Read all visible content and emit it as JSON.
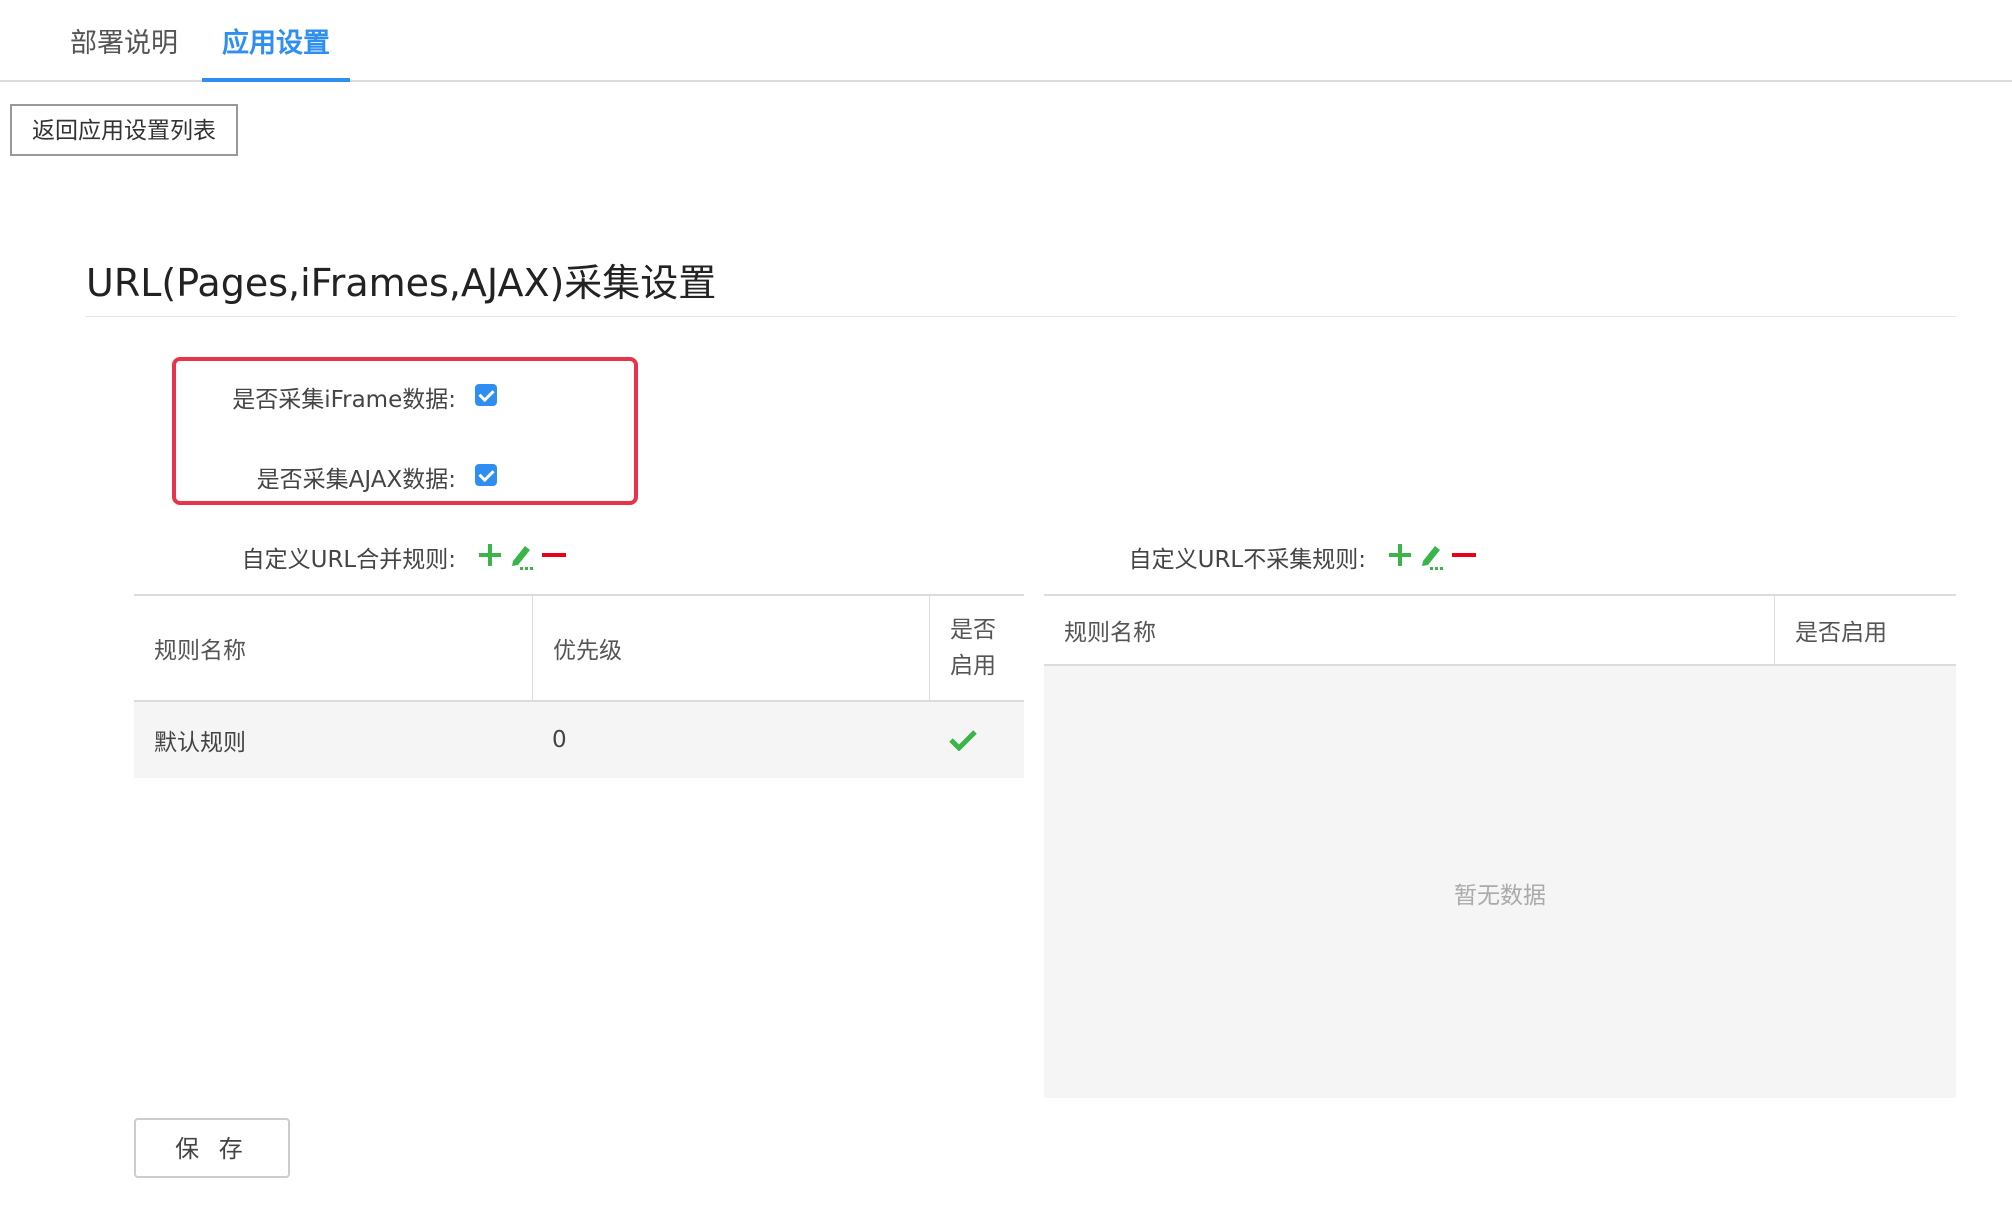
{
  "tabs": [
    {
      "label": "部署说明",
      "active": false
    },
    {
      "label": "应用设置",
      "active": true
    }
  ],
  "back_button_label": "返回应用设置列表",
  "section_title": "URL(Pages,iFrames,AJAX)采集设置",
  "settings": {
    "iframe_label": "是否采集iFrame数据:",
    "iframe_checked": true,
    "ajax_label": "是否采集AJAX数据:",
    "ajax_checked": true
  },
  "merge_rules": {
    "label": "自定义URL合并规则:",
    "columns": [
      "规则名称",
      "优先级",
      "是否\n启用"
    ],
    "rows": [
      {
        "name": "默认规则",
        "priority": "0",
        "enabled": true
      }
    ]
  },
  "exclude_rules": {
    "label": "自定义URL不采集规则:",
    "columns": [
      "规则名称",
      "是否启用"
    ],
    "empty_text": "暂无数据"
  },
  "save_button_label": "保 存",
  "colors": {
    "accent": "#2f8ff0",
    "add_green": "#3bb54a",
    "remove_red": "#e8001c",
    "highlight_red": "#e8334a"
  },
  "icons": [
    "plus-icon",
    "edit-icon",
    "minus-icon",
    "check-icon"
  ]
}
